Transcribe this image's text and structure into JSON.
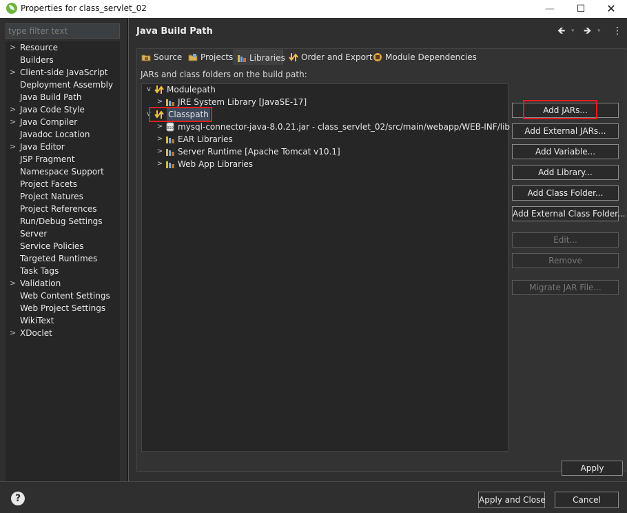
{
  "window": {
    "title": "Properties for class_servlet_02",
    "minimize_glyph": "—",
    "maximize_glyph": "☐",
    "close_glyph": "✕"
  },
  "filter": {
    "placeholder": "type filter text"
  },
  "nav": [
    {
      "label": "Resource",
      "expandable": true
    },
    {
      "label": "Builders",
      "expandable": false
    },
    {
      "label": "Client-side JavaScript",
      "expandable": true
    },
    {
      "label": "Deployment Assembly",
      "expandable": false
    },
    {
      "label": "Java Build Path",
      "expandable": false
    },
    {
      "label": "Java Code Style",
      "expandable": true
    },
    {
      "label": "Java Compiler",
      "expandable": true
    },
    {
      "label": "Javadoc Location",
      "expandable": false
    },
    {
      "label": "Java Editor",
      "expandable": true
    },
    {
      "label": "JSP Fragment",
      "expandable": false
    },
    {
      "label": "Namespace Support",
      "expandable": false
    },
    {
      "label": "Project Facets",
      "expandable": false
    },
    {
      "label": "Project Natures",
      "expandable": false
    },
    {
      "label": "Project References",
      "expandable": false
    },
    {
      "label": "Run/Debug Settings",
      "expandable": false
    },
    {
      "label": "Server",
      "expandable": false
    },
    {
      "label": "Service Policies",
      "expandable": false
    },
    {
      "label": "Targeted Runtimes",
      "expandable": false
    },
    {
      "label": "Task Tags",
      "expandable": false
    },
    {
      "label": "Validation",
      "expandable": true
    },
    {
      "label": "Web Content Settings",
      "expandable": false
    },
    {
      "label": "Web Project Settings",
      "expandable": false
    },
    {
      "label": "WikiText",
      "expandable": false
    },
    {
      "label": "XDoclet",
      "expandable": true
    }
  ],
  "page": {
    "title": "Java Build Path",
    "back_glyph": "🡸",
    "forward_glyph": "🡺",
    "menu_glyph": "⋮"
  },
  "tabs": [
    {
      "label": "Source",
      "icon": "source-folder-icon",
      "active": false
    },
    {
      "label": "Projects",
      "icon": "projects-icon",
      "active": false
    },
    {
      "label": "Libraries",
      "icon": "libraries-icon",
      "active": true
    },
    {
      "label": "Order and Export",
      "icon": "order-export-icon",
      "active": false
    },
    {
      "label": "Module Dependencies",
      "icon": "module-dependencies-icon",
      "active": false
    }
  ],
  "build_path_label": "JARs and class folders on the build path:",
  "tree": {
    "modulepath": {
      "label": "Modulepath",
      "children": [
        {
          "label": "JRE System Library [JavaSE-17]"
        }
      ]
    },
    "classpath": {
      "label": "Classpath",
      "children": [
        {
          "label": "mysql-connector-java-8.0.21.jar - class_servlet_02/src/main/webapp/WEB-INF/lib",
          "icon": "jar-icon"
        },
        {
          "label": "EAR Libraries",
          "icon": "library-icon"
        },
        {
          "label": "Server Runtime [Apache Tomcat v10.1]",
          "icon": "library-icon"
        },
        {
          "label": "Web App Libraries",
          "icon": "library-icon"
        }
      ]
    }
  },
  "buttons": {
    "add_jars": "Add JARs...",
    "add_external_jars": "Add External JARs...",
    "add_variable": "Add Variable...",
    "add_library": "Add Library...",
    "add_class_folder": "Add Class Folder...",
    "add_external_class_folder": "Add External Class Folder...",
    "edit": "Edit...",
    "remove": "Remove",
    "migrate_jar": "Migrate JAR File...",
    "apply": "Apply",
    "apply_and_close": "Apply and Close",
    "cancel": "Cancel",
    "help": "?"
  },
  "colors": {
    "highlight": "#e0201f",
    "background": "#2f2f2f",
    "tree_background": "#262626"
  }
}
